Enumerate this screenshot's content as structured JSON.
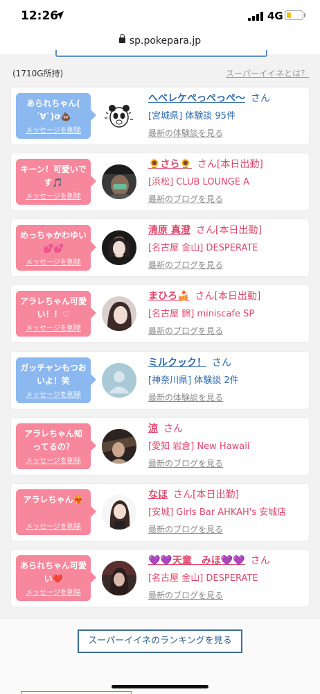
{
  "status": {
    "time": "12:26",
    "network": "4G"
  },
  "browser": {
    "url": "sp.pokepara.jp"
  },
  "header": {
    "owned": "(1710G所持)",
    "link": "スーパーイイネとは？"
  },
  "cards": [
    {
      "message": "あられちゃん( ´∀`)σ💩",
      "delete": "メッセージを削除",
      "name": "へべレケぺっぺっぺ～",
      "suffix": "さん",
      "shop": "[宮城県] 体験談 95件",
      "more": "最新の体験談を見る",
      "color": "blue",
      "avatar": "panda-avatar"
    },
    {
      "message": "キーン！可愛いです🎵",
      "delete": "メッセージを削除",
      "name": "🌻さら🌻",
      "suffix": "さん[本日出勤]",
      "shop": "[浜松] CLUB LOUNGE A",
      "more": "最新のブログを見る",
      "color": "pink",
      "avatar": "photo-avatar"
    },
    {
      "message": "めっちゃかわゆい💕💕",
      "delete": "メッセージを削除",
      "name": "清原 真澄",
      "suffix": "さん[本日出勤]",
      "shop": "[名古屋 金山] DESPERATE",
      "more": "最新のブログを見る",
      "color": "pink",
      "avatar": "photo-avatar"
    },
    {
      "message": "アラレちゃん可愛い！！♡",
      "delete": "メッセージを削除",
      "name": "まひろ🍰",
      "suffix": "さん[本日出勤]",
      "shop": "[名古屋 錦] miniscafe SP",
      "more": "最新のブログを見る",
      "color": "pink",
      "avatar": "photo-avatar"
    },
    {
      "message": "ガッチャンもつおいよ！笑",
      "delete": "メッセージを削除",
      "name": "ミルクック！",
      "suffix": "さん",
      "shop": "[神奈川県] 体験談 2件",
      "more": "最新の体験談を見る",
      "color": "blue",
      "avatar": "no-photo-avatar"
    },
    {
      "message": "アラレちゃん知ってるの？",
      "delete": "メッセージを削除",
      "name": "涼",
      "suffix": "さん",
      "shop": "[愛知 岩倉] New Hawaii",
      "more": "最新のブログを見る",
      "color": "pink",
      "avatar": "photo-avatar"
    },
    {
      "message": "アラレちゃん❤️‍🔥",
      "delete": "メッセージを削除",
      "name": "なほ",
      "suffix": "さん[本日出勤]",
      "shop": "[安城] Girls Bar AHKAH's 安城店",
      "more": "最新のブログを見る",
      "color": "pink",
      "avatar": "photo-avatar"
    },
    {
      "message": "あられちゃん可愛い❤️",
      "delete": "メッセージを削除",
      "name": "💜💜天童　みほ💜💜",
      "suffix": "さん",
      "shop": "[名古屋 金山] DESPERATE",
      "more": "最新のブログを見る",
      "color": "pink",
      "avatar": "photo-avatar"
    }
  ],
  "footer": {
    "ranking": "スーパーイイネのランキングを見る"
  },
  "colors": {
    "blue": "#8cb8f0",
    "pink": "#f7879c",
    "link_blue": "#2d68ad",
    "link_pink": "#e0456b"
  }
}
